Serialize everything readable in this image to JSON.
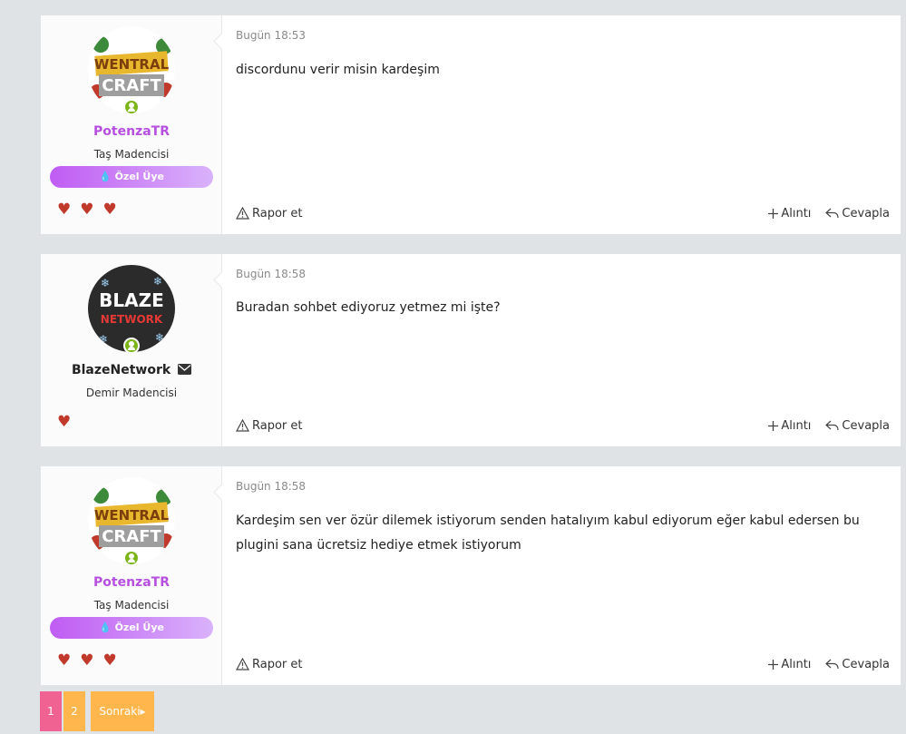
{
  "posts": [
    {
      "username": "PotenzaTR",
      "user_title": "Taş Madencisi",
      "banner": "Özel Üye",
      "avatar_text_top": "WENTRAL",
      "avatar_text_bottom": "CRAFT",
      "hearts": 3,
      "date": "Bugün 18:53",
      "message": "discordunu verir misin kardeşim"
    },
    {
      "username": "BlazeNetwork",
      "user_title": "Demir Madencisi",
      "avatar_text_top": "BLAZE",
      "avatar_text_bottom": "NETWORK",
      "hearts": 1,
      "date": "Bugün 18:58",
      "message": "Buradan sohbet ediyoruz yetmez mi işte?"
    },
    {
      "username": "PotenzaTR",
      "user_title": "Taş Madencisi",
      "banner": "Özel Üye",
      "avatar_text_top": "WENTRAL",
      "avatar_text_bottom": "CRAFT",
      "hearts": 3,
      "date": "Bugün 18:58",
      "message": "Kardeşim sen ver özür dilemek istiyorum senden hatalıyım kabul ediyorum eğer kabul edersen bu plugini sana ücretsiz hediye etmek istiyorum"
    }
  ],
  "actions": {
    "report": "Rapor et",
    "quote": "Alıntı",
    "reply": "Cevapla"
  },
  "pagination": {
    "pages": [
      "1",
      "2"
    ],
    "current": "1",
    "next": "Sonraki"
  },
  "colors": {
    "username_special": "#b64fe0",
    "banner_start": "#c05cf3",
    "banner_end": "#d9b2fb",
    "heart": "#c0392b",
    "online": "#7cb518",
    "page_active": "#f06292",
    "page_inactive": "#ffb74d"
  },
  "icons": {
    "report": "warning-triangle-icon",
    "quote": "plus-icon",
    "reply": "reply-arrow-icon",
    "banner": "drop-icon",
    "dm": "envelope-icon",
    "online": "user-online-icon"
  }
}
